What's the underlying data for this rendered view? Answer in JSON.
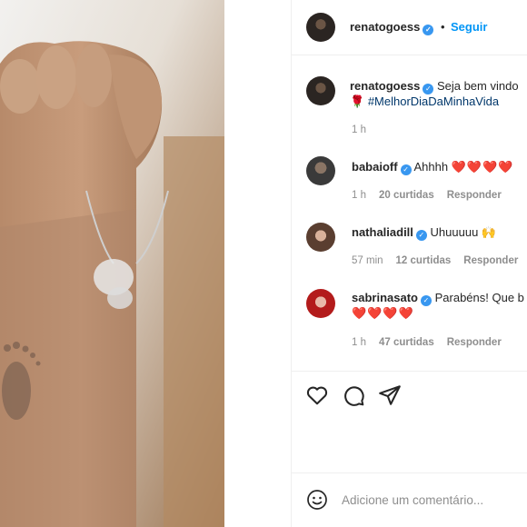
{
  "header": {
    "username": "renatogoess",
    "follow_label": "Seguir",
    "separator": "•"
  },
  "caption": {
    "username": "renatogoess",
    "text_line1": "Seja bem vindo",
    "hashtag": "#MelhorDiaDaMinhaVida",
    "flower": "🌹",
    "time": "1 h"
  },
  "comments": [
    {
      "username": "babaioff",
      "text": "Ahhhh ",
      "hearts": "❤️❤️❤️❤️",
      "time": "1 h",
      "likes": "20 curtidas",
      "reply": "Responder"
    },
    {
      "username": "nathaliadill",
      "text": "Uhuuuuu ",
      "emoji": "🙌",
      "time": "57 min",
      "likes": "12 curtidas",
      "reply": "Responder"
    },
    {
      "username": "sabrinasato",
      "text": "Parabéns! Que b",
      "hearts": "❤️❤️❤️❤️",
      "time": "1 h",
      "likes": "47 curtidas",
      "reply": "Responder"
    }
  ],
  "composer": {
    "placeholder": "Adicione um comentário..."
  },
  "icons": {
    "like": "heart-icon",
    "comment": "comment-icon",
    "share": "share-icon",
    "emoji": "smiley-icon",
    "verified": "verified-badge-icon"
  },
  "colors": {
    "accent": "#0095f6",
    "verified": "#3897f0",
    "heart": "#ed1c2e"
  }
}
